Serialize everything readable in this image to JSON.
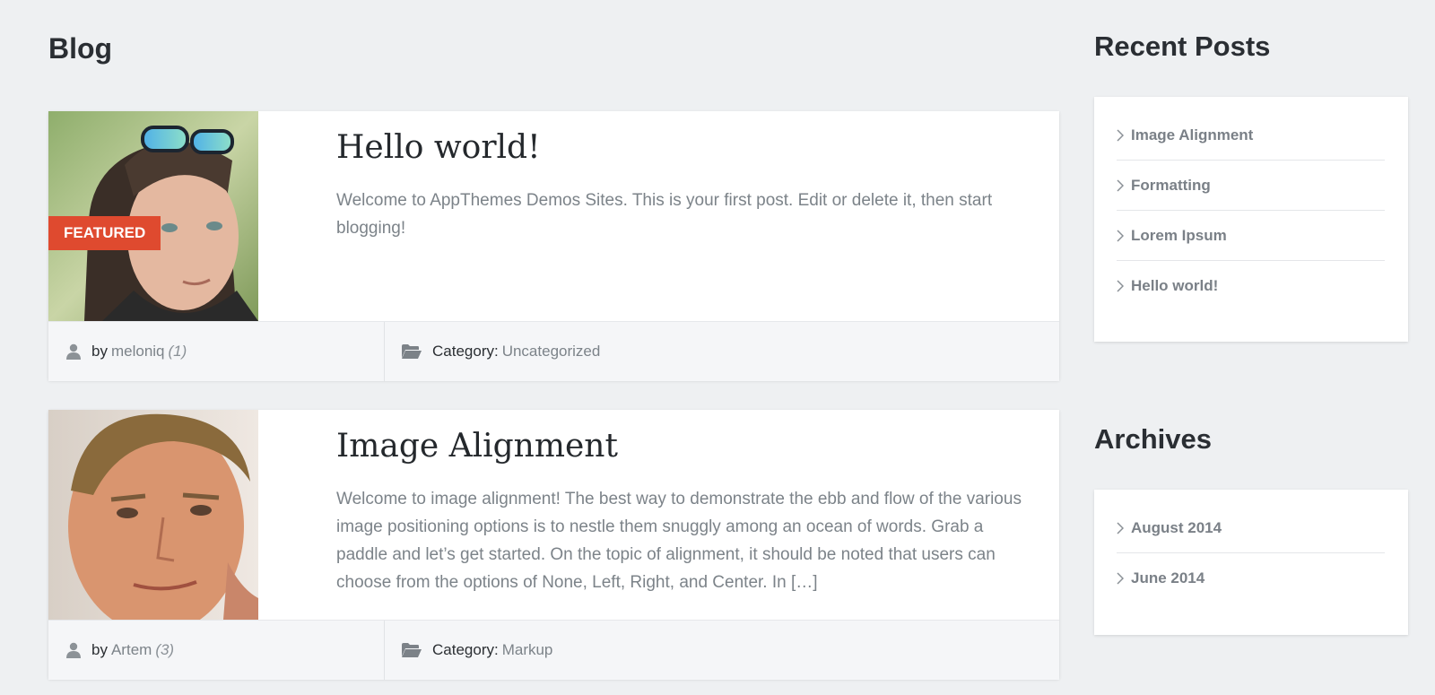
{
  "page": {
    "title": "Blog"
  },
  "posts": [
    {
      "title": "Hello world!",
      "excerpt": "Welcome to AppThemes Demos Sites. This is your first post. Edit or delete it, then start blogging!",
      "badge": "FEATURED",
      "author_prefix": "by",
      "author": "meloniq",
      "author_count": "(1)",
      "category_label": "Category:",
      "category": "Uncategorized",
      "thumbnail": "portrait-photo-man-sunglasses"
    },
    {
      "title": "Image Alignment",
      "excerpt": "Welcome to image alignment! The best way to demonstrate the ebb and flow of the various image positioning options is to nestle them snuggly among an ocean of words. Grab a paddle and let’s get started. On the topic of alignment, it should be noted that users can choose from the options of None, Left, Right, and Center. In […]",
      "author_prefix": "by",
      "author": "Artem",
      "author_count": "(3)",
      "category_label": "Category:",
      "category": "Markup",
      "thumbnail": "portrait-photo-man"
    }
  ],
  "sidebar": {
    "recent_posts": {
      "title": "Recent Posts",
      "items": [
        "Image Alignment",
        "Formatting",
        "Lorem Ipsum",
        "Hello world!"
      ]
    },
    "archives": {
      "title": "Archives",
      "items": [
        "August 2014",
        "June 2014"
      ]
    }
  },
  "colors": {
    "background": "#eef0f2",
    "badge": "#df4a2f",
    "muted_text": "#7c8389",
    "meta_bg": "#f5f6f8"
  },
  "icons": {
    "author": "user-icon",
    "category": "folder-icon",
    "list": "chevron-right-icon"
  }
}
